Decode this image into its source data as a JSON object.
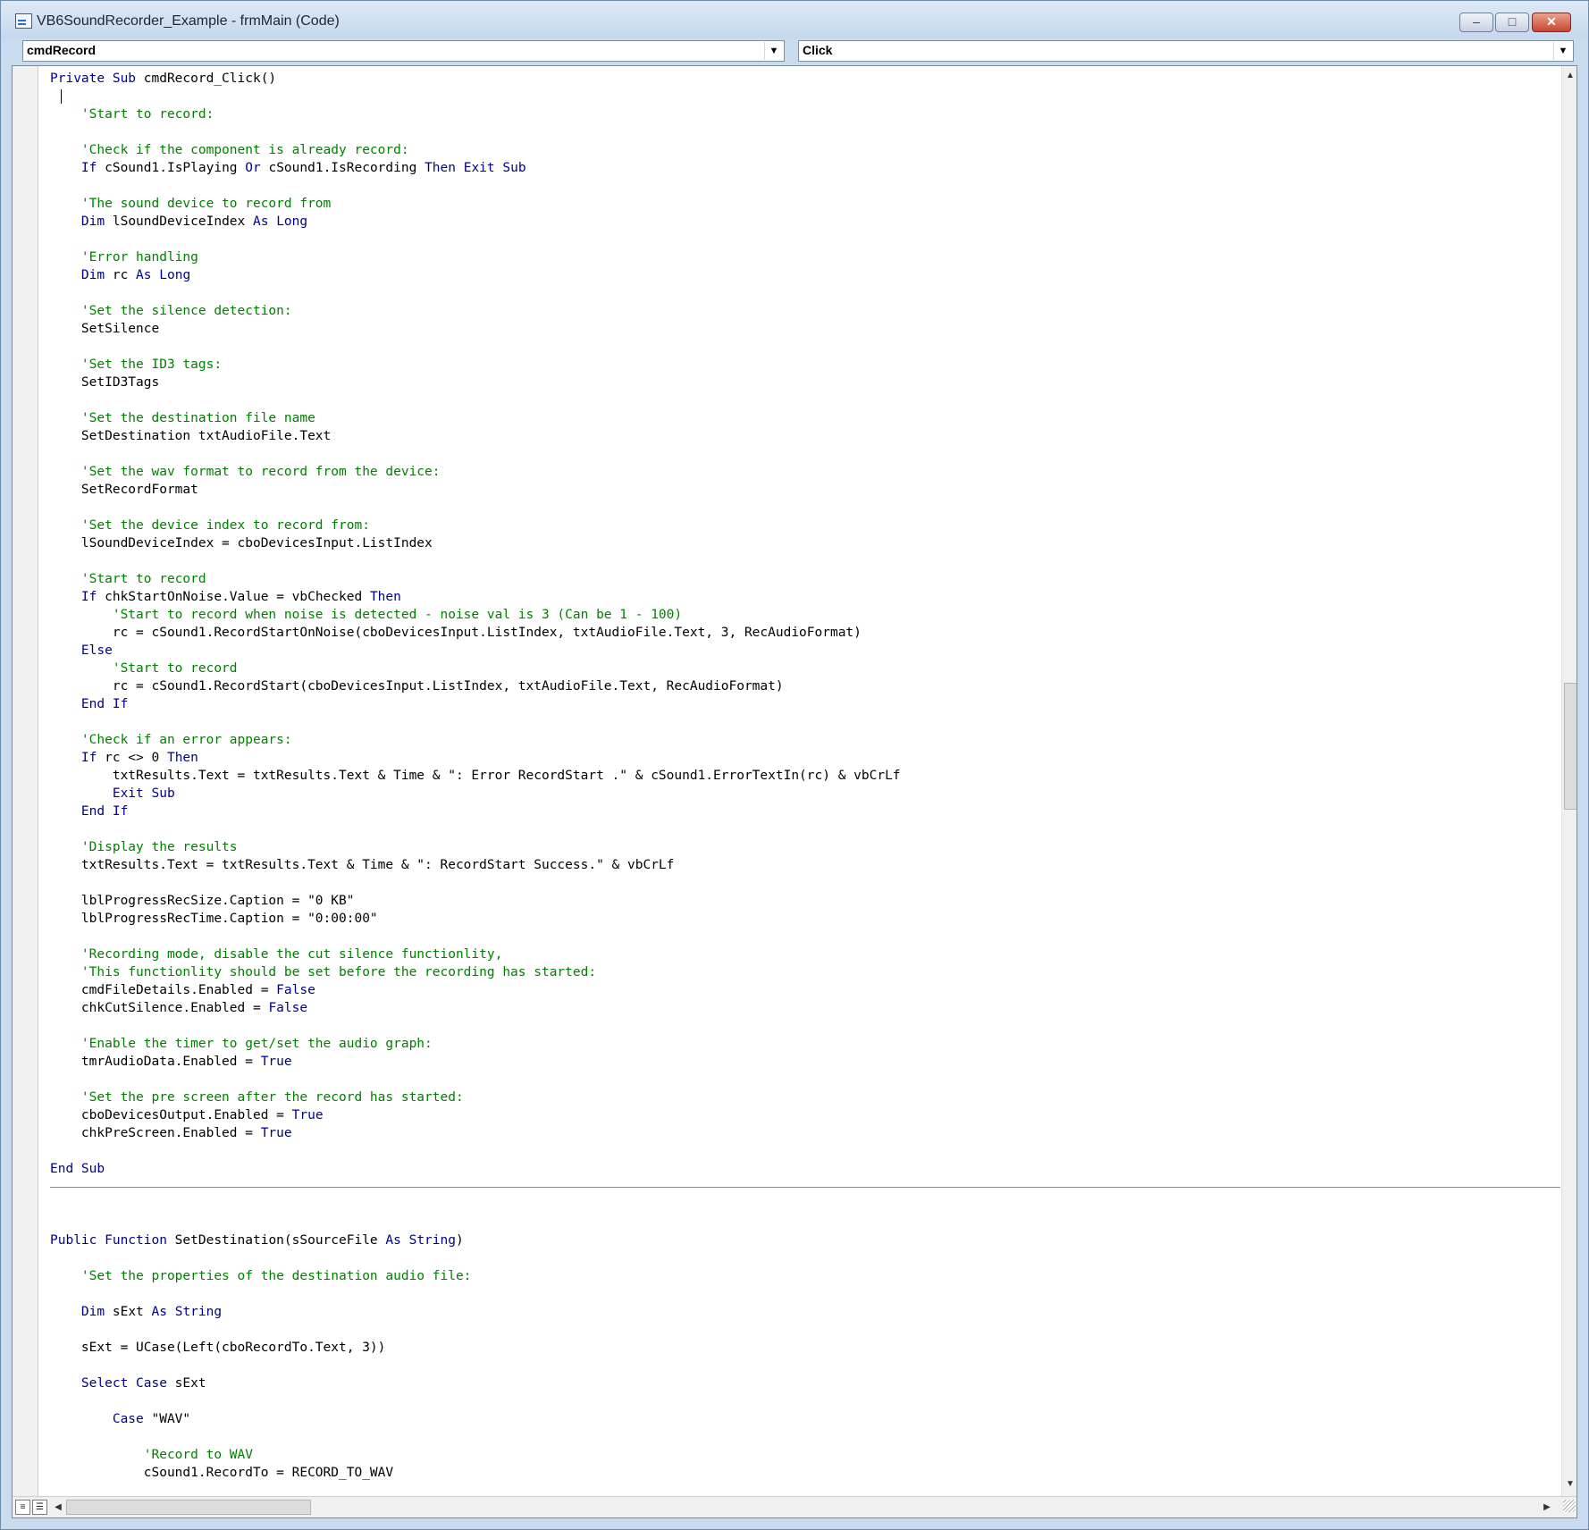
{
  "window": {
    "title": "VB6SoundRecorder_Example - frmMain (Code)",
    "controls": {
      "minimize": "–",
      "maximize": "□",
      "close": "✕"
    }
  },
  "object_combo": {
    "value": "cmdRecord",
    "arrow": "▼"
  },
  "procedure_combo": {
    "value": "Click",
    "arrow": "▼"
  },
  "scroll": {
    "up": "▲",
    "down": "▼",
    "left": "◀",
    "right": "▶"
  },
  "view_buttons": {
    "procedure": "≡",
    "full_module": "☰"
  },
  "code_lines": [
    [
      {
        "t": "Private Sub",
        "c": "kw"
      },
      {
        "t": " cmdRecord_Click()"
      }
    ],
    [],
    [
      {
        "t": "    'Start to record:",
        "c": "cm"
      }
    ],
    [],
    [
      {
        "t": "    'Check if the component is already record:",
        "c": "cm"
      }
    ],
    [
      {
        "t": "    "
      },
      {
        "t": "If",
        "c": "kw"
      },
      {
        "t": " cSound1.IsPlaying "
      },
      {
        "t": "Or",
        "c": "kw"
      },
      {
        "t": " cSound1.IsRecording "
      },
      {
        "t": "Then",
        "c": "kw"
      },
      {
        "t": " "
      },
      {
        "t": "Exit Sub",
        "c": "kw"
      }
    ],
    [],
    [
      {
        "t": "    'The sound device to record from",
        "c": "cm"
      }
    ],
    [
      {
        "t": "    "
      },
      {
        "t": "Dim",
        "c": "kw"
      },
      {
        "t": " lSoundDeviceIndex "
      },
      {
        "t": "As",
        "c": "kw"
      },
      {
        "t": " "
      },
      {
        "t": "Long",
        "c": "kw"
      }
    ],
    [],
    [
      {
        "t": "    'Error handling",
        "c": "cm"
      }
    ],
    [
      {
        "t": "    "
      },
      {
        "t": "Dim",
        "c": "kw"
      },
      {
        "t": " rc "
      },
      {
        "t": "As",
        "c": "kw"
      },
      {
        "t": " "
      },
      {
        "t": "Long",
        "c": "kw"
      }
    ],
    [],
    [
      {
        "t": "    'Set the silence detection:",
        "c": "cm"
      }
    ],
    [
      {
        "t": "    SetSilence"
      }
    ],
    [],
    [
      {
        "t": "    'Set the ID3 tags:",
        "c": "cm"
      }
    ],
    [
      {
        "t": "    SetID3Tags"
      }
    ],
    [],
    [
      {
        "t": "    'Set the destination file name",
        "c": "cm"
      }
    ],
    [
      {
        "t": "    SetDestination txtAudioFile.Text"
      }
    ],
    [],
    [
      {
        "t": "    'Set the wav format to record from the device:",
        "c": "cm"
      }
    ],
    [
      {
        "t": "    SetRecordFormat"
      }
    ],
    [],
    [
      {
        "t": "    'Set the device index to record from:",
        "c": "cm"
      }
    ],
    [
      {
        "t": "    lSoundDeviceIndex = cboDevicesInput.ListIndex"
      }
    ],
    [],
    [
      {
        "t": "    'Start to record",
        "c": "cm"
      }
    ],
    [
      {
        "t": "    "
      },
      {
        "t": "If",
        "c": "kw"
      },
      {
        "t": " chkStartOnNoise.Value = vbChecked "
      },
      {
        "t": "Then",
        "c": "kw"
      }
    ],
    [
      {
        "t": "        'Start to record when noise is detected - noise val is 3 (Can be 1 - 100)",
        "c": "cm"
      }
    ],
    [
      {
        "t": "        rc = cSound1.RecordStartOnNoise(cboDevicesInput.ListIndex, txtAudioFile.Text, 3, RecAudioFormat)"
      }
    ],
    [
      {
        "t": "    "
      },
      {
        "t": "Else",
        "c": "kw"
      }
    ],
    [
      {
        "t": "        'Start to record",
        "c": "cm"
      }
    ],
    [
      {
        "t": "        rc = cSound1.RecordStart(cboDevicesInput.ListIndex, txtAudioFile.Text, RecAudioFormat)"
      }
    ],
    [
      {
        "t": "    "
      },
      {
        "t": "End If",
        "c": "kw"
      }
    ],
    [],
    [
      {
        "t": "    'Check if an error appears:",
        "c": "cm"
      }
    ],
    [
      {
        "t": "    "
      },
      {
        "t": "If",
        "c": "kw"
      },
      {
        "t": " rc <> 0 "
      },
      {
        "t": "Then",
        "c": "kw"
      }
    ],
    [
      {
        "t": "        txtResults.Text = txtResults.Text & Time & \": Error RecordStart .\" & cSound1.ErrorTextIn(rc) & vbCrLf"
      }
    ],
    [
      {
        "t": "        "
      },
      {
        "t": "Exit Sub",
        "c": "kw"
      }
    ],
    [
      {
        "t": "    "
      },
      {
        "t": "End If",
        "c": "kw"
      }
    ],
    [],
    [
      {
        "t": "    'Display the results",
        "c": "cm"
      }
    ],
    [
      {
        "t": "    txtResults.Text = txtResults.Text & Time & \": RecordStart Success.\" & vbCrLf"
      }
    ],
    [],
    [
      {
        "t": "    lblProgressRecSize.Caption = \"0 KB\""
      }
    ],
    [
      {
        "t": "    lblProgressRecTime.Caption = \"0:00:00\""
      }
    ],
    [],
    [
      {
        "t": "    'Recording mode, disable the cut silence functionlity,",
        "c": "cm"
      }
    ],
    [
      {
        "t": "    'This functionlity should be set before the recording has started:",
        "c": "cm"
      }
    ],
    [
      {
        "t": "    cmdFileDetails.Enabled = "
      },
      {
        "t": "False",
        "c": "kw"
      }
    ],
    [
      {
        "t": "    chkCutSilence.Enabled = "
      },
      {
        "t": "False",
        "c": "kw"
      }
    ],
    [],
    [
      {
        "t": "    'Enable the timer to get/set the audio graph:",
        "c": "cm"
      }
    ],
    [
      {
        "t": "    tmrAudioData.Enabled = "
      },
      {
        "t": "True",
        "c": "kw"
      }
    ],
    [],
    [
      {
        "t": "    'Set the pre screen after the record has started:",
        "c": "cm"
      }
    ],
    [
      {
        "t": "    cboDevicesOutput.Enabled = "
      },
      {
        "t": "True",
        "c": "kw"
      }
    ],
    [
      {
        "t": "    chkPreScreen.Enabled = "
      },
      {
        "t": "True",
        "c": "kw"
      }
    ],
    [],
    [
      {
        "t": "End Sub",
        "c": "kw"
      }
    ],
    "SEP",
    [],
    [],
    [
      {
        "t": "Public Function",
        "c": "kw"
      },
      {
        "t": " SetDestination(sSourceFile "
      },
      {
        "t": "As",
        "c": "kw"
      },
      {
        "t": " "
      },
      {
        "t": "String",
        "c": "kw"
      },
      {
        "t": ")"
      }
    ],
    [],
    [
      {
        "t": "    'Set the properties of the destination audio file:",
        "c": "cm"
      }
    ],
    [],
    [
      {
        "t": "    "
      },
      {
        "t": "Dim",
        "c": "kw"
      },
      {
        "t": " sExt "
      },
      {
        "t": "As",
        "c": "kw"
      },
      {
        "t": " "
      },
      {
        "t": "String",
        "c": "kw"
      }
    ],
    [],
    [
      {
        "t": "    sExt = UCase(Left(cboRecordTo.Text, 3))"
      }
    ],
    [],
    [
      {
        "t": "    "
      },
      {
        "t": "Select Case",
        "c": "kw"
      },
      {
        "t": " sExt"
      }
    ],
    [],
    [
      {
        "t": "        "
      },
      {
        "t": "Case",
        "c": "kw"
      },
      {
        "t": " \"WAV\""
      }
    ],
    [],
    [
      {
        "t": "            'Record to WAV",
        "c": "cm"
      }
    ],
    [
      {
        "t": "            cSound1.RecordTo = RECORD_TO_WAV"
      }
    ]
  ]
}
